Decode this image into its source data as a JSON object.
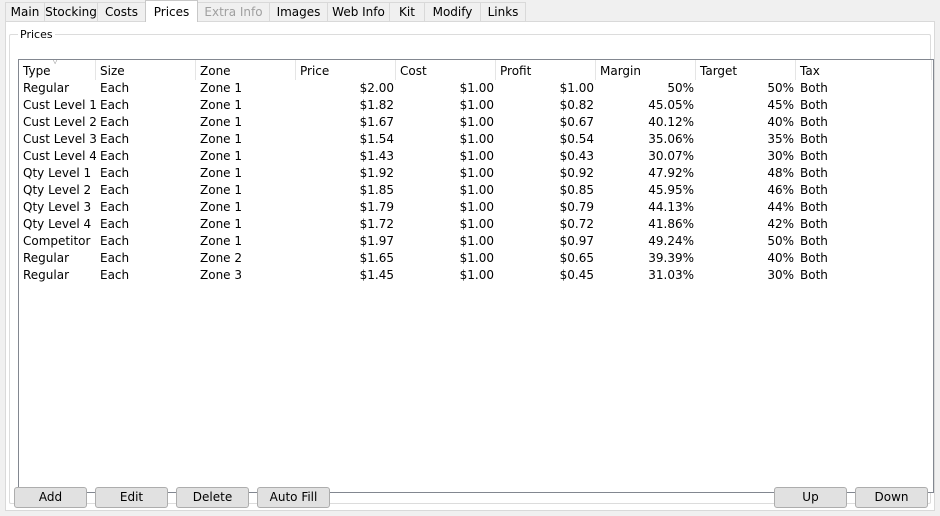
{
  "tabs": [
    {
      "label": "Main",
      "state": "normal"
    },
    {
      "label": "Stocking",
      "state": "normal"
    },
    {
      "label": "Costs",
      "state": "normal"
    },
    {
      "label": "Prices",
      "state": "active"
    },
    {
      "label": "Extra Info",
      "state": "disabled"
    },
    {
      "label": "Images",
      "state": "normal"
    },
    {
      "label": "Web Info",
      "state": "normal"
    },
    {
      "label": "Kit",
      "state": "normal"
    },
    {
      "label": "Modify",
      "state": "normal"
    },
    {
      "label": "Links",
      "state": "normal"
    }
  ],
  "prices_group": {
    "label": "Prices",
    "columns": [
      "Type",
      "Size",
      "Zone",
      "Price",
      "Cost",
      "Profit",
      "Margin",
      "Target",
      "Tax"
    ],
    "rows": [
      [
        "Regular",
        "Each",
        "Zone 1",
        "$2.00",
        "$1.00",
        "$1.00",
        "50%",
        "50%",
        "Both"
      ],
      [
        "Cust Level 1",
        "Each",
        "Zone 1",
        "$1.82",
        "$1.00",
        "$0.82",
        "45.05%",
        "45%",
        "Both"
      ],
      [
        "Cust Level 2",
        "Each",
        "Zone 1",
        "$1.67",
        "$1.00",
        "$0.67",
        "40.12%",
        "40%",
        "Both"
      ],
      [
        "Cust Level 3",
        "Each",
        "Zone 1",
        "$1.54",
        "$1.00",
        "$0.54",
        "35.06%",
        "35%",
        "Both"
      ],
      [
        "Cust Level 4",
        "Each",
        "Zone 1",
        "$1.43",
        "$1.00",
        "$0.43",
        "30.07%",
        "30%",
        "Both"
      ],
      [
        "Qty Level 1",
        "Each",
        "Zone 1",
        "$1.92",
        "$1.00",
        "$0.92",
        "47.92%",
        "48%",
        "Both"
      ],
      [
        "Qty Level 2",
        "Each",
        "Zone 1",
        "$1.85",
        "$1.00",
        "$0.85",
        "45.95%",
        "46%",
        "Both"
      ],
      [
        "Qty Level 3",
        "Each",
        "Zone 1",
        "$1.79",
        "$1.00",
        "$0.79",
        "44.13%",
        "44%",
        "Both"
      ],
      [
        "Qty Level 4",
        "Each",
        "Zone 1",
        "$1.72",
        "$1.00",
        "$0.72",
        "41.86%",
        "42%",
        "Both"
      ],
      [
        "Competitor",
        "Each",
        "Zone 1",
        "$1.97",
        "$1.00",
        "$0.97",
        "49.24%",
        "50%",
        "Both"
      ],
      [
        "Regular",
        "Each",
        "Zone 2",
        "$1.65",
        "$1.00",
        "$0.65",
        "39.39%",
        "40%",
        "Both"
      ],
      [
        "Regular",
        "Each",
        "Zone 3",
        "$1.45",
        "$1.00",
        "$0.45",
        "31.03%",
        "30%",
        "Both"
      ]
    ]
  },
  "buttons": {
    "add": "Add",
    "edit": "Edit",
    "delete": "Delete",
    "auto_fill": "Auto Fill",
    "up": "Up",
    "down": "Down"
  }
}
